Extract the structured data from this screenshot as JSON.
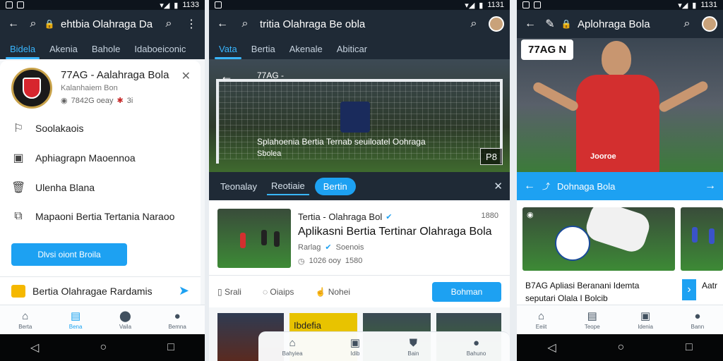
{
  "screen1": {
    "status_time": "1133",
    "appbar_title": "ehtbia Olahraga Da",
    "tabs": [
      "Bidela",
      "Akenia",
      "Bahole",
      "Idaboeiconic"
    ],
    "profile": {
      "name": "77AG - Aalahraga Bola",
      "subtitle": "Kalanhaiem Bon",
      "meta": "7842G oeay",
      "meta2": "3i"
    },
    "menu": [
      "Soolakaois",
      "Aphiagrapn Maoennoa",
      "Ulenha Blana",
      "Mapaoni Bertia Tertania Naraoo"
    ],
    "button_label": "Dlvsi oiont Broila",
    "promo_text": "Bertia Olahragae Rardamis",
    "nav": [
      "Berta",
      "Bena",
      "Vaila",
      "Bemna"
    ]
  },
  "screen2": {
    "status_time": "1131",
    "appbar_title": "tritia Olahraga Be obla",
    "tabs": [
      "Vata",
      "Bertia",
      "Akenale",
      "Abiticar"
    ],
    "hero_title": "77AG -",
    "hero_caption": "Splahoenia Bertia Ternab seuiloatel Oohraga",
    "hero_caption2": "Sbolea",
    "hero_badge": "P8",
    "chips": [
      "Teonalay",
      "Reotiaie",
      "Bertin"
    ],
    "news": {
      "title": "Tertia - Olahraga Bol",
      "time": "1880",
      "headline": "Aplikasni Bertia Tertinar Olahraga Bola",
      "meta": "Rarlag",
      "meta2": "Soenois",
      "stat": "1026 ooy",
      "stat2": "1580"
    },
    "actions": [
      "Srali",
      "Oiaips",
      "Nohei",
      "Bohman"
    ],
    "grid_caption": "Ibdefia",
    "nav": [
      "Bahyiea",
      "Idib",
      "Bain",
      "Bahuno"
    ]
  },
  "screen3": {
    "status_time": "1131",
    "appbar_title": "Aplohraga Bola",
    "hero_tag": "77AG N",
    "jersey_text": "Jooroe",
    "bar_title": "Dohnaga Bola",
    "card_title": "B7AG Apliasi Beranani Idemta",
    "card_sub": "seputari Olala I Bolcib",
    "card_more": "Aatr",
    "nav": [
      "Eeiit",
      "Teope",
      "Idenia",
      "Bann"
    ]
  }
}
